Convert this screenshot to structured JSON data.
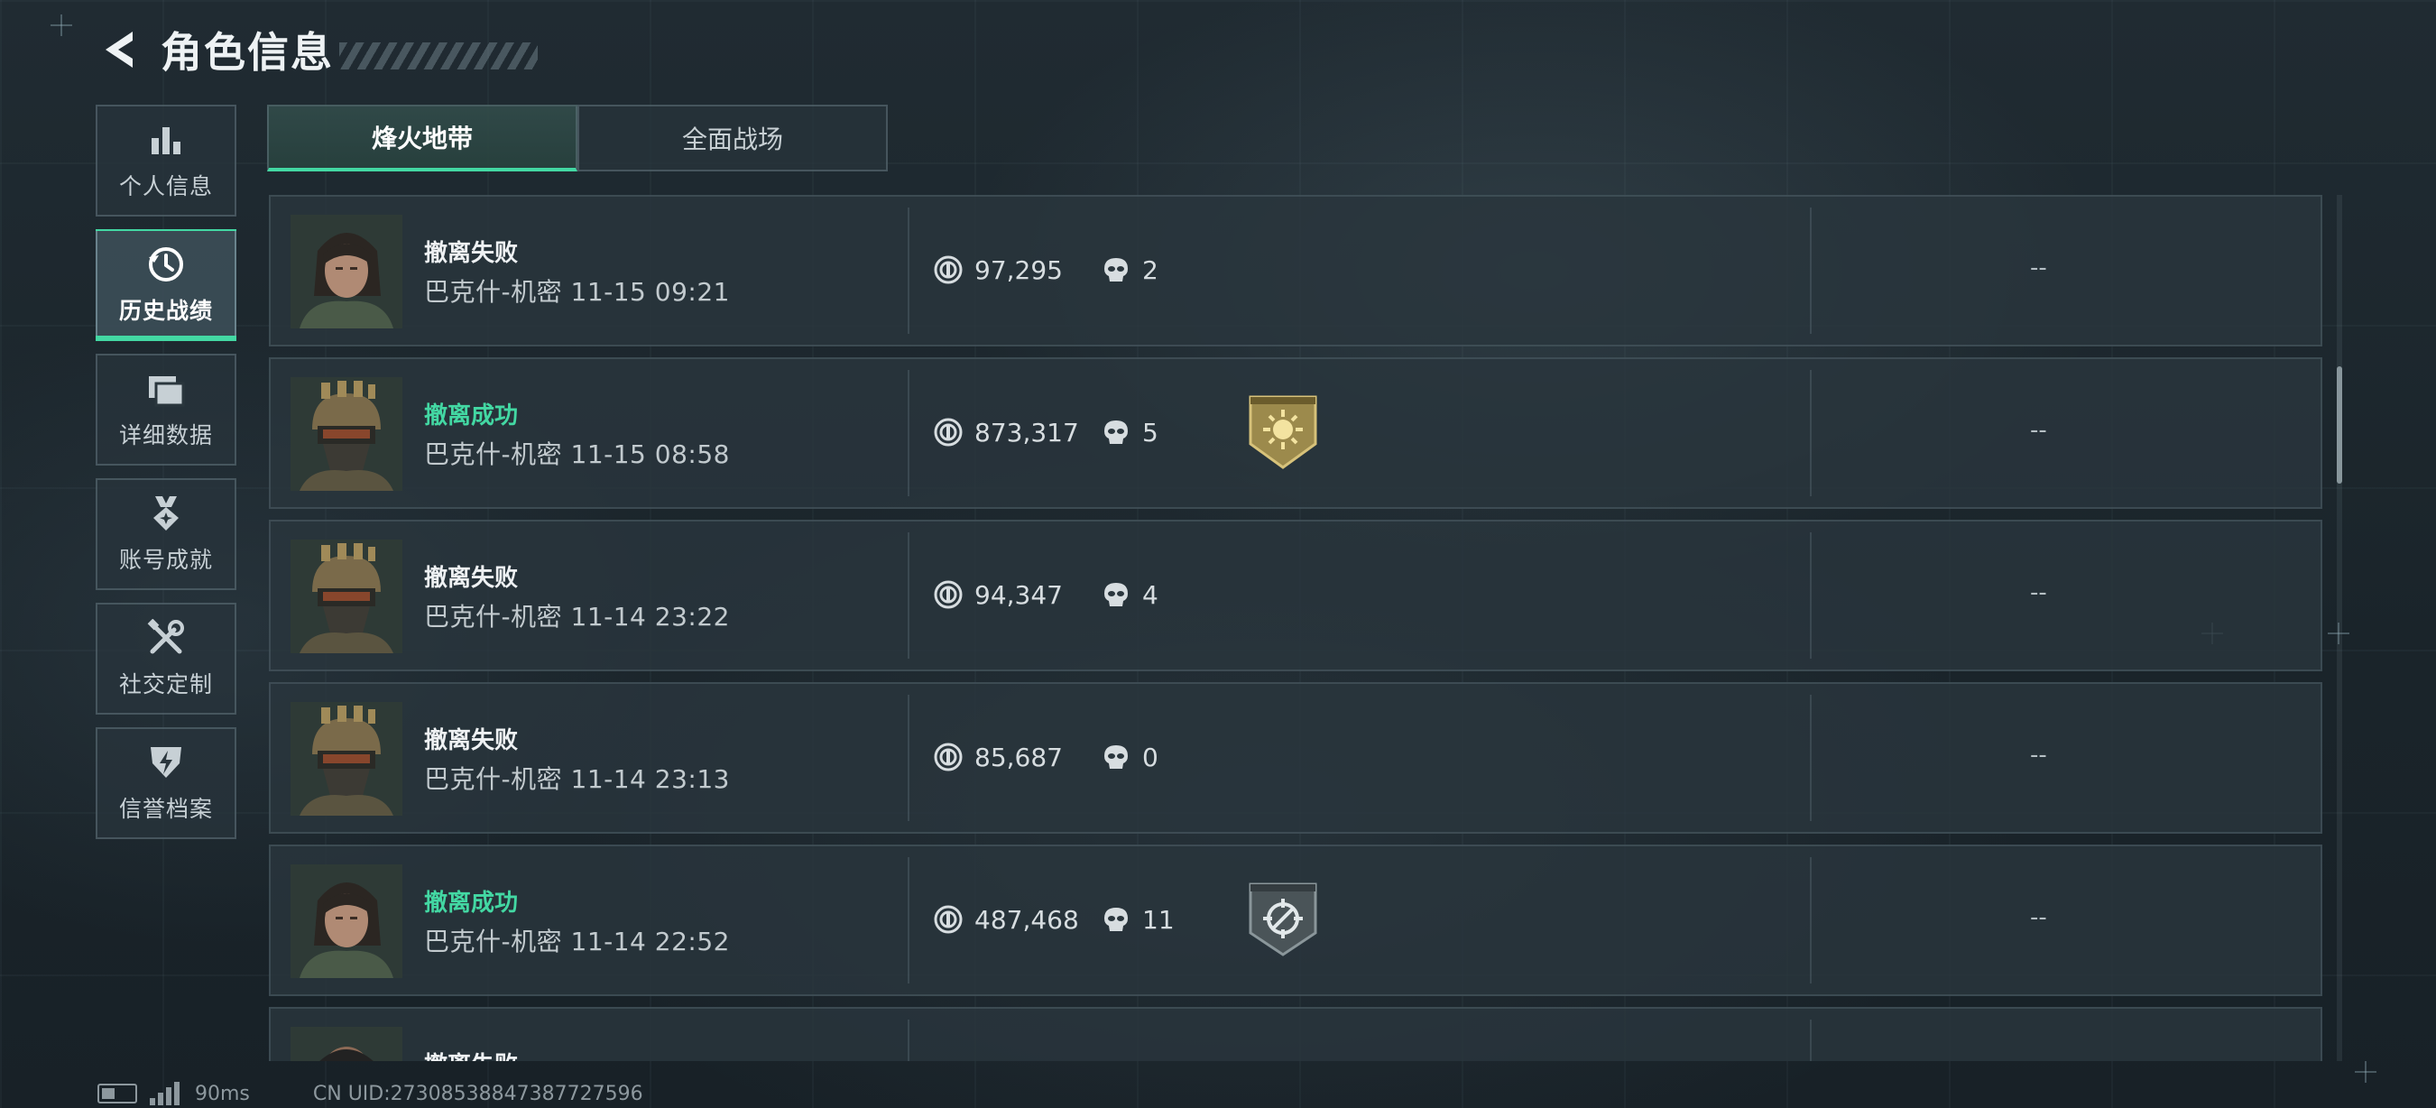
{
  "header": {
    "title": "角色信息"
  },
  "sidebar": {
    "items": [
      {
        "label": "个人信息",
        "icon": "bar-chart-icon",
        "active": false
      },
      {
        "label": "历史战绩",
        "icon": "clock-history-icon",
        "active": true
      },
      {
        "label": "详细数据",
        "icon": "folders-icon",
        "active": false
      },
      {
        "label": "账号成就",
        "icon": "medal-icon",
        "active": false
      },
      {
        "label": "社交定制",
        "icon": "tools-icon",
        "active": false
      },
      {
        "label": "信誉档案",
        "icon": "shield-lightning-icon",
        "active": false
      }
    ]
  },
  "tabs": [
    {
      "label": "烽火地带",
      "active": true
    },
    {
      "label": "全面战场",
      "active": false
    }
  ],
  "records": [
    {
      "result": "撤离失败",
      "success": false,
      "map_time": "巴克什-机密 11-15 09:21",
      "value": "97,295",
      "kills": "2",
      "badge": "",
      "extra": "--",
      "avatar": "female-operator"
    },
    {
      "result": "撤离成功",
      "success": true,
      "map_time": "巴克什-机密 11-15 08:58",
      "value": "873,317",
      "kills": "5",
      "badge": "gold-sun-badge",
      "extra": "--",
      "avatar": "helmet-operator"
    },
    {
      "result": "撤离失败",
      "success": false,
      "map_time": "巴克什-机密 11-14 23:22",
      "value": "94,347",
      "kills": "4",
      "badge": "",
      "extra": "--",
      "avatar": "helmet-operator"
    },
    {
      "result": "撤离失败",
      "success": false,
      "map_time": "巴克什-机密 11-14 23:13",
      "value": "85,687",
      "kills": "0",
      "badge": "",
      "extra": "--",
      "avatar": "helmet-operator"
    },
    {
      "result": "撤离成功",
      "success": true,
      "map_time": "巴克什-机密 11-14 22:52",
      "value": "487,468",
      "kills": "11",
      "badge": "gray-crosshair-badge",
      "extra": "--",
      "avatar": "female-operator"
    },
    {
      "result": "撤离失败",
      "success": false,
      "map_time": "",
      "value": "",
      "kills": "",
      "badge": "",
      "extra": "",
      "avatar": "bald-operator"
    }
  ],
  "footer": {
    "ping": "90ms",
    "uid": "CN UID:27308538847387727596"
  },
  "colors": {
    "accent": "#43d8a3",
    "success": "#43d8a3",
    "gold_badge": "#b8a15a"
  }
}
